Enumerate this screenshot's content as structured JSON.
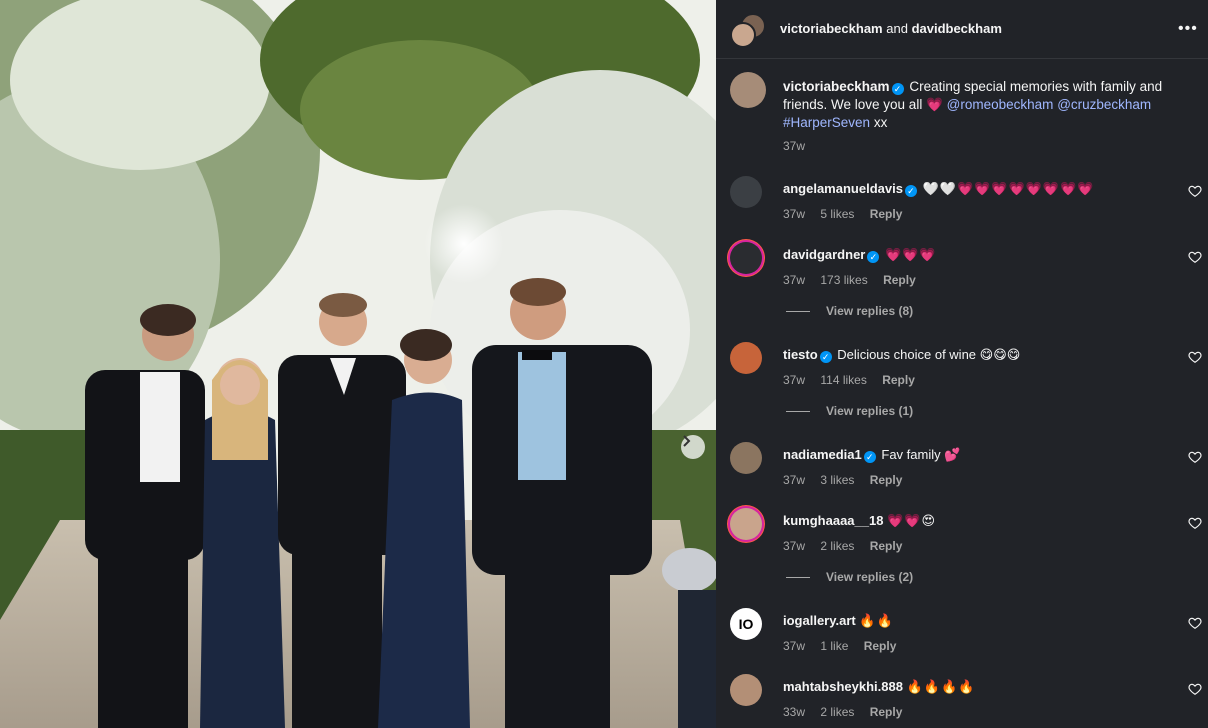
{
  "header": {
    "user1": "victoriabeckham",
    "and": "and",
    "user2": "davidbeckham",
    "more_icon": "more-horizontal-icon"
  },
  "caption": {
    "username": "victoriabeckham",
    "text": "Creating special memories with family and friends. We love you all",
    "heart": "💗",
    "mention1": "@romeobeckham",
    "mention2": "@cruzbeckham",
    "hashtag": "#HarperSeven",
    "suffix": "xx",
    "time": "37w"
  },
  "comments": [
    {
      "username": "angelamanueldavis",
      "verified": true,
      "text": "🤍🤍💗💗💗💗💗💗💗💗",
      "time": "37w",
      "likes": "5 likes",
      "reply": "Reply",
      "avatar_color": "#3b3f44"
    },
    {
      "username": "davidgardner",
      "verified": true,
      "text": "💗💗💗",
      "time": "37w",
      "likes": "173 likes",
      "reply": "Reply",
      "avatar_color": "#2a2c30",
      "view_replies": "View replies (8)"
    },
    {
      "username": "tiesto",
      "verified": true,
      "text": "Delicious choice of wine 😋😋😋",
      "time": "37w",
      "likes": "114 likes",
      "reply": "Reply",
      "avatar_color": "#c7643a",
      "view_replies": "View replies (1)"
    },
    {
      "username": "nadiamedia1",
      "verified": true,
      "text": "Fav family 💕",
      "time": "37w",
      "likes": "3 likes",
      "reply": "Reply",
      "avatar_color": "#8b7560"
    },
    {
      "username": "kumghaaaa__18",
      "verified": false,
      "text": "💗💗😍",
      "time": "37w",
      "likes": "2 likes",
      "reply": "Reply",
      "avatar_color": "#c9a48c",
      "view_replies": "View replies (2)"
    },
    {
      "username": "iogallery.art",
      "verified": false,
      "text": "🔥🔥",
      "time": "37w",
      "likes": "1 like",
      "reply": "Reply",
      "avatar_color": "#ffffff",
      "avatar_text": "IO"
    },
    {
      "username": "mahtabsheykhi.888",
      "verified": false,
      "text": "🔥🔥🔥🔥",
      "time": "33w",
      "likes": "2 likes",
      "reply": "Reply",
      "avatar_color": "#b38f76"
    }
  ]
}
